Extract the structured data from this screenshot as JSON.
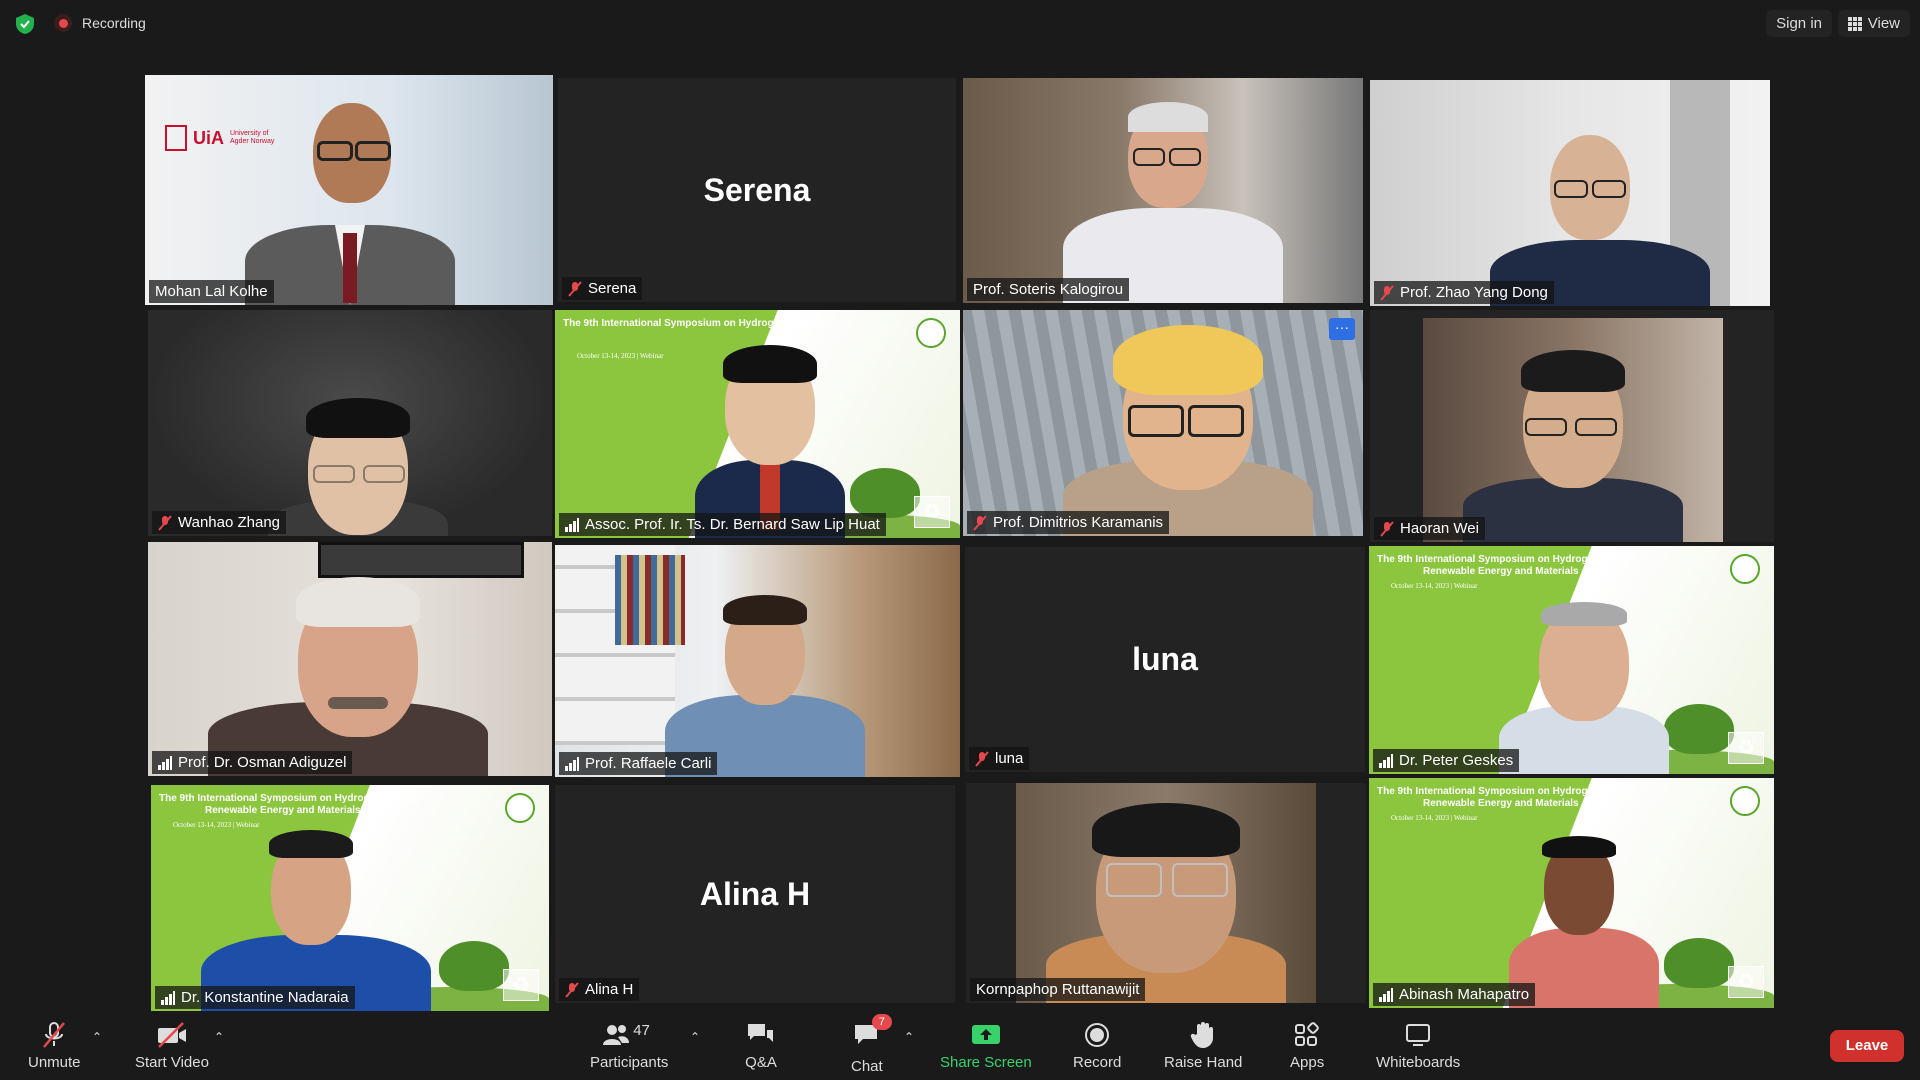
{
  "topbar": {
    "recording_label": "Recording",
    "sign_in_label": "Sign in",
    "view_label": "View"
  },
  "tiles": [
    {
      "name": "Mohan Lal Kolhe",
      "muted": false,
      "active": true,
      "logo_text": "UiA",
      "logo_subtext": "University of Agder Norway"
    },
    {
      "name": "Serena",
      "muted": true,
      "center_name": "Serena"
    },
    {
      "name": "Prof. Soteris Kalogirou",
      "muted": false
    },
    {
      "name": "Prof. Zhao Yang Dong",
      "muted": true
    },
    {
      "name": "Wanhao Zhang",
      "muted": true
    },
    {
      "name": "Assoc. Prof. Ir. Ts. Dr. Bernard Saw Lip Huat",
      "muted": false
    },
    {
      "name": "Prof. Dimitrios Karamanis",
      "muted": true
    },
    {
      "name": "Haoran Wei",
      "muted": true
    },
    {
      "name": "Prof. Dr. Osman Adiguzel",
      "muted": false
    },
    {
      "name": "Prof. Raffaele Carli",
      "muted": false
    },
    {
      "name": "luna",
      "muted": true,
      "center_name": "luna"
    },
    {
      "name": "Dr. Peter Geskes",
      "muted": false
    },
    {
      "name": "Dr. Konstantine Nadaraia",
      "muted": false
    },
    {
      "name": "Alina H",
      "muted": true,
      "center_name": "Alina H"
    },
    {
      "name": "Kornpaphop Ruttanawijit",
      "muted": false
    },
    {
      "name": "Abinash Mahapatro",
      "muted": false
    }
  ],
  "slide": {
    "title_line1": "The 9th International Symposium on Hydrogen Energy,",
    "title_line2": "Renewable Energy and Materials",
    "date": "October 13-14, 2023 | Webinar"
  },
  "toolbar": {
    "unmute": "Unmute",
    "start_video": "Start Video",
    "participants": "Participants",
    "participants_count": "47",
    "qa": "Q&A",
    "chat": "Chat",
    "chat_badge": "7",
    "share_screen": "Share Screen",
    "record": "Record",
    "raise_hand": "Raise Hand",
    "apps": "Apps",
    "whiteboards": "Whiteboards",
    "leave": "Leave"
  },
  "colors": {
    "active_speaker": "#d4e84a",
    "share_green": "#38d26b",
    "leave_red": "#d0312d",
    "muted_red": "#e5484d"
  },
  "icons": [
    "shield-icon",
    "record-icon",
    "grid-view-icon",
    "mic-muted-icon",
    "video-off-icon",
    "participants-icon",
    "qa-icon",
    "chat-icon",
    "share-screen-icon",
    "record-button-icon",
    "raise-hand-icon",
    "apps-icon",
    "whiteboard-icon",
    "signal-icon",
    "more-icon"
  ]
}
